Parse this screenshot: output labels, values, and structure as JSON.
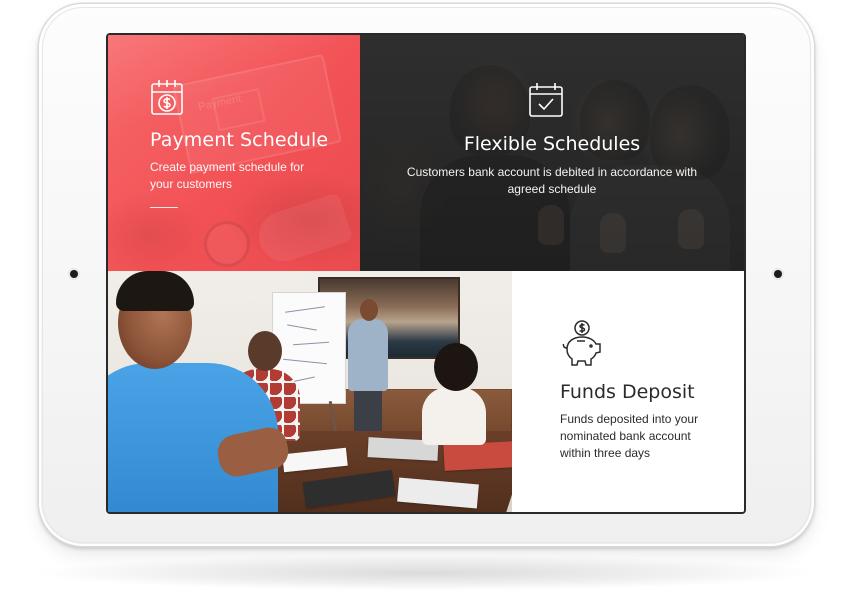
{
  "colors": {
    "payment_accent": "#f2565a",
    "flex_overlay": "#3a3a3a",
    "text_dark": "#2b2b2b",
    "text_light": "#ffffff"
  },
  "panels": {
    "payment": {
      "icon": "calendar-dollar-icon",
      "title": "Payment Schedule",
      "description": "Create payment schedule for your customers",
      "background_text": "Payment"
    },
    "flexible": {
      "icon": "calendar-check-icon",
      "title": "Flexible Schedules",
      "description": "Customers bank account is debited in accordance with agreed schedule"
    },
    "funds": {
      "icon": "piggy-bank-dollar-icon",
      "title": "Funds Deposit",
      "description": "Funds deposited into your nominated bank account within three days"
    }
  }
}
